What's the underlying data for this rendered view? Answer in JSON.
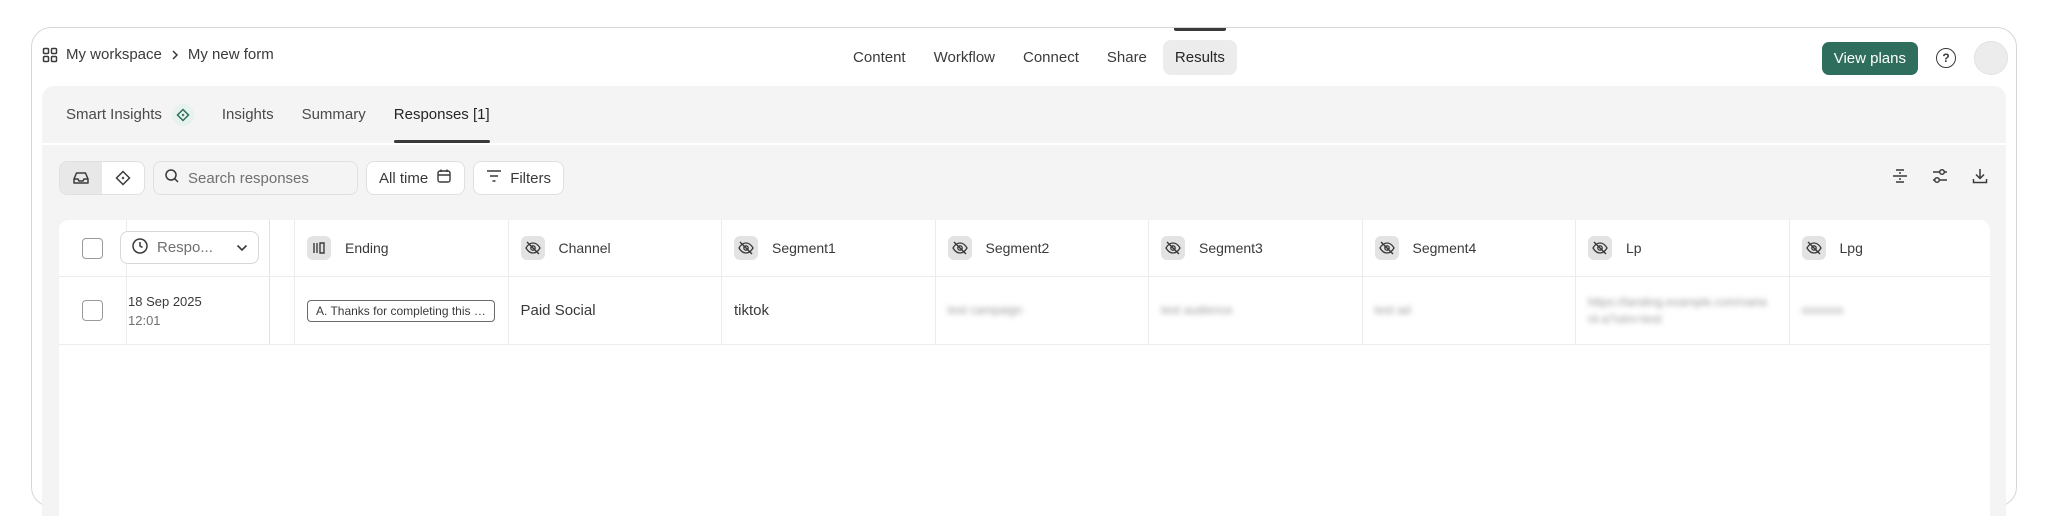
{
  "breadcrumb": {
    "workspace": "My workspace",
    "form": "My new form"
  },
  "nav": {
    "items": [
      {
        "label": "Content",
        "active": false
      },
      {
        "label": "Workflow",
        "active": false
      },
      {
        "label": "Connect",
        "active": false
      },
      {
        "label": "Share",
        "active": false
      },
      {
        "label": "Results",
        "active": true
      }
    ]
  },
  "header": {
    "view_plans_label": "View plans",
    "help_icon": "?"
  },
  "subtabs": {
    "smart_insights": "Smart Insights",
    "insights": "Insights",
    "summary": "Summary",
    "responses": "Responses [1]"
  },
  "toolbar": {
    "search_placeholder": "Search responses",
    "time_filter_label": "All time",
    "filters_label": "Filters"
  },
  "table": {
    "sort_label": "Respo...",
    "columns": [
      {
        "label": "Ending",
        "icon": "ending-icon"
      },
      {
        "label": "Channel",
        "icon": "hidden-eye-icon"
      },
      {
        "label": "Segment1",
        "icon": "hidden-eye-icon"
      },
      {
        "label": "Segment2",
        "icon": "hidden-eye-icon"
      },
      {
        "label": "Segment3",
        "icon": "hidden-eye-icon"
      },
      {
        "label": "Segment4",
        "icon": "hidden-eye-icon"
      },
      {
        "label": "Lp",
        "icon": "hidden-eye-icon"
      },
      {
        "label": "Lpg",
        "icon": "hidden-eye-icon"
      }
    ],
    "rows": [
      {
        "date": "18 Sep 2025",
        "time": "12:01",
        "ending": "A. Thanks for completing this form",
        "channel": "Paid Social",
        "segment1": "tiktok",
        "segment2": "test campaign",
        "segment3": "test audience",
        "segment4": "test ad",
        "lp": "https://landing.example.com/variant-a?utm=test",
        "lpg": "xxxxxxx"
      }
    ]
  },
  "colors": {
    "accent": "#2f6e5c",
    "panel_bg": "#f4f4f4"
  }
}
